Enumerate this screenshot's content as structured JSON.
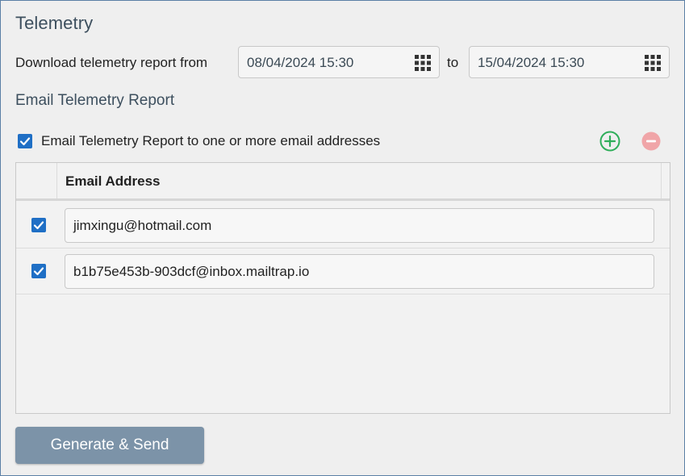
{
  "panel": {
    "title": "Telemetry"
  },
  "download_range": {
    "label": "Download telemetry report from",
    "from_value": "08/04/2024 15:30",
    "to_label": "to",
    "to_value": "15/04/2024 15:30"
  },
  "email_section": {
    "title": "Email Telemetry Report",
    "toggle_label": "Email Telemetry Report to one or more email addresses",
    "toggle_checked": true
  },
  "email_table": {
    "column_header": "Email Address",
    "rows": [
      {
        "checked": true,
        "email": "jimxingu@hotmail.com"
      },
      {
        "checked": true,
        "email": "b1b75e453b-903dcf@inbox.mailtrap.io"
      }
    ]
  },
  "actions": {
    "generate_label": "Generate & Send"
  },
  "icons": {
    "calendar": "calendar-grid-icon",
    "add": "plus-circle-icon",
    "remove": "minus-circle-icon"
  },
  "colors": {
    "accent_blue": "#1f6fc5",
    "add_green": "#2fae5a",
    "remove_red_disabled": "#f0a5a8",
    "button_bg": "#7c93a8",
    "title_color": "#3d4f5e"
  }
}
